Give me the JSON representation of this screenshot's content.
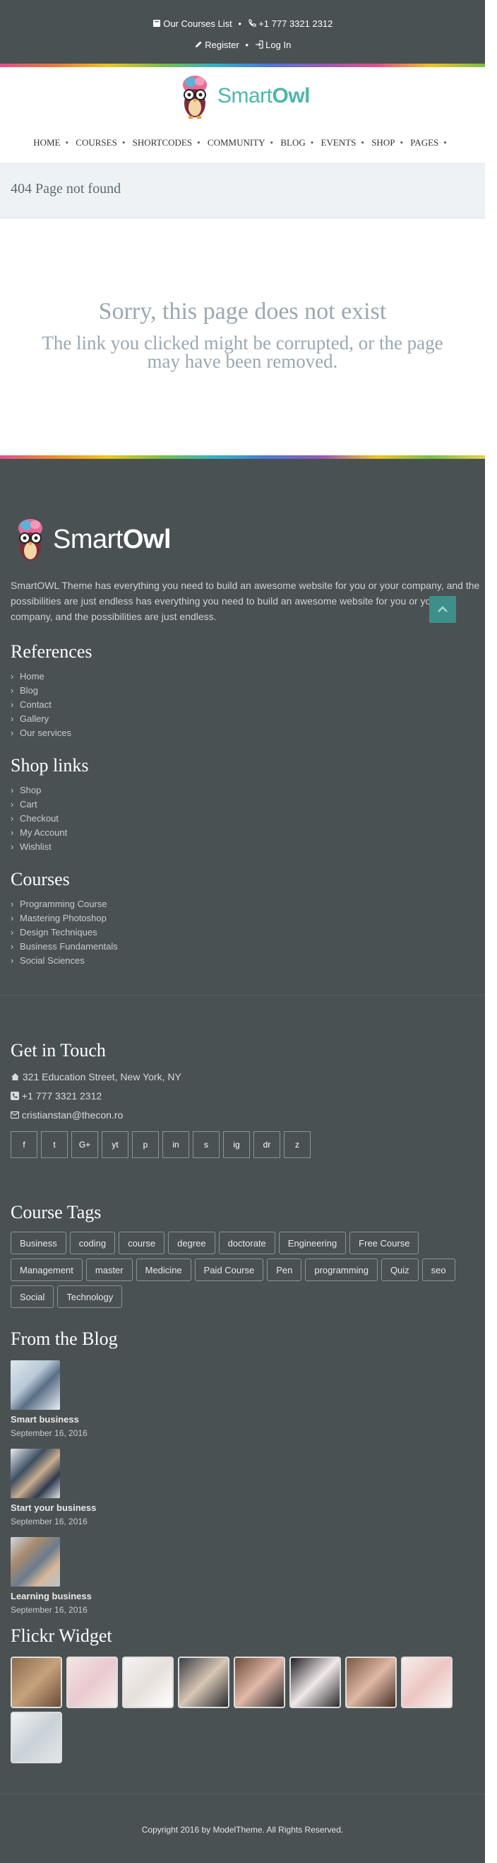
{
  "topbar": {
    "courses_list": "Our Courses List",
    "phone": "+1 777 3321 2312",
    "register": "Register",
    "login": "Log In"
  },
  "brand": {
    "name_light": "Smart",
    "name_bold": "Owl",
    "accent": "#4db6ac"
  },
  "nav": {
    "items": [
      "HOME",
      "COURSES",
      "SHORTCODES",
      "COMMUNITY",
      "BLOG",
      "EVENTS",
      "SHOP",
      "PAGES"
    ]
  },
  "page": {
    "title": "404 Page not found",
    "error_heading": "Sorry, this page does not exist",
    "error_text": "The link you clicked might be corrupted, or the page may have been removed."
  },
  "footer": {
    "description": "SmartOWL Theme has everything you need to build an awesome website for you or your company, and the possibilities are just endless has everything you need to build an awesome website for you or your company, and the possibilities are just endless.",
    "references": {
      "heading": "References",
      "items": [
        "Home",
        "Blog",
        "Contact",
        "Gallery",
        "Our services"
      ]
    },
    "shop_links": {
      "heading": "Shop links",
      "items": [
        "Shop",
        "Cart",
        "Checkout",
        "My Account",
        "Wishlist"
      ]
    },
    "courses": {
      "heading": "Courses",
      "items": [
        "Programming Course",
        "Mastering Photoshop",
        "Design Techniques",
        "Business Fundamentals",
        "Social Sciences"
      ]
    },
    "contact": {
      "heading": "Get in Touch",
      "address": "321 Education Street, New York, NY",
      "phone": "+1 777 3321 2312",
      "email": "cristianstan@thecon.ro"
    },
    "social": [
      "f",
      "t",
      "G+",
      "yt",
      "p",
      "in",
      "s",
      "ig",
      "dr",
      "z"
    ],
    "tags": {
      "heading": "Course Tags",
      "items": [
        "Business",
        "coding",
        "course",
        "degree",
        "doctorate",
        "Engineering",
        "Free Course",
        "Management",
        "master",
        "Medicine",
        "Paid Course",
        "Pen",
        "programming",
        "Quiz",
        "seo",
        "Social",
        "Technology"
      ]
    },
    "blog": {
      "heading": "From the Blog",
      "posts": [
        {
          "title": "Smart business",
          "date": "September 16, 2016"
        },
        {
          "title": "Start your business",
          "date": "September 16, 2016"
        },
        {
          "title": "Learning business",
          "date": "September 16, 2016"
        }
      ]
    },
    "flickr": {
      "heading": "Flickr Widget"
    },
    "copyright": "Copyright 2016 by ModelTheme. All Rights Reserved."
  }
}
